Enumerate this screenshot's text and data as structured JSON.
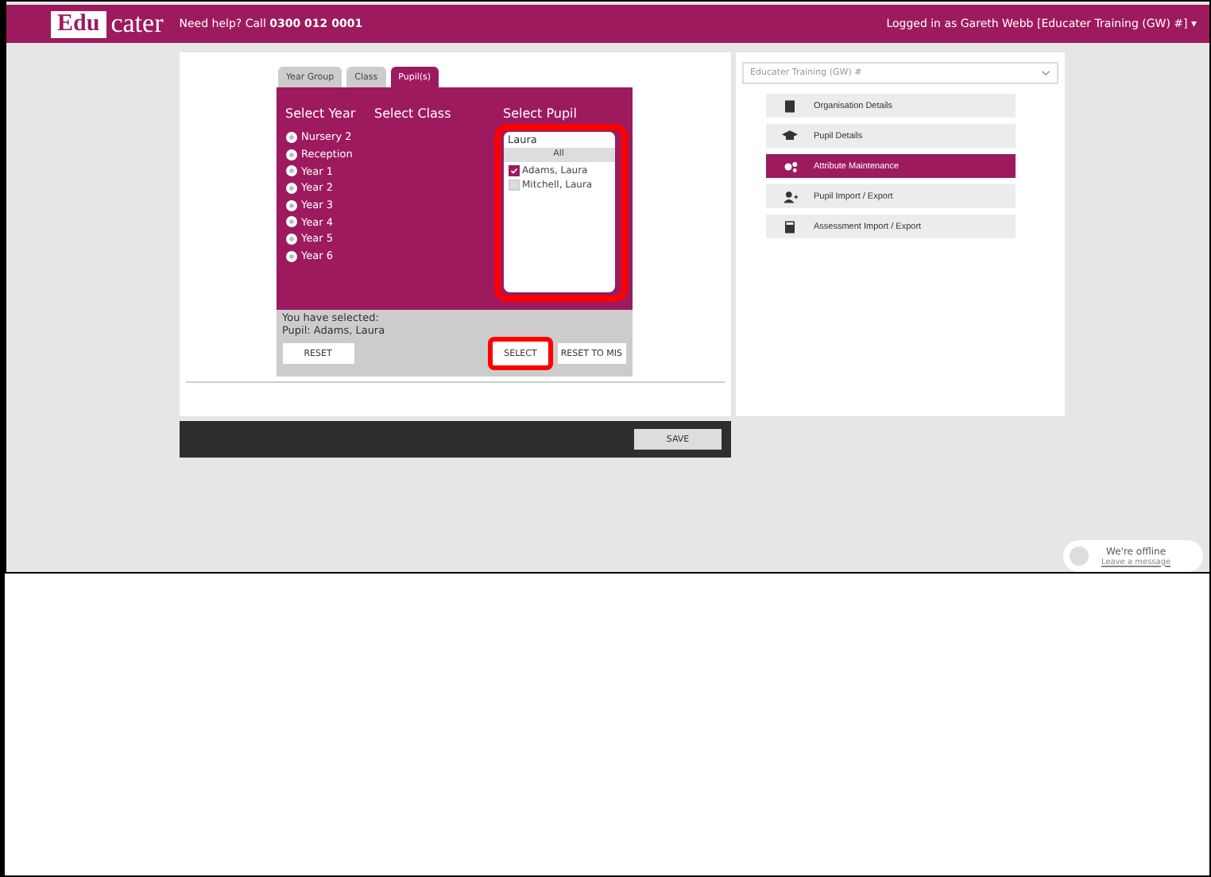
{
  "header": {
    "logo_left": "Edu",
    "logo_right": "cater",
    "help_text": "Need help? Call",
    "help_phone": "0300 012 0001",
    "user": "Logged in as Gareth Webb [Educater Training (GW) #]",
    "user_caret": "▾"
  },
  "tabs": [
    {
      "label": "Year Group",
      "selected": false
    },
    {
      "label": "Class",
      "selected": false
    },
    {
      "label": "Pupil(s)",
      "selected": true
    }
  ],
  "columns": {
    "year": "Select Year",
    "class": "Select Class",
    "pupil": "Select Pupil"
  },
  "years": [
    {
      "label": "Nursery 2",
      "selected": false
    },
    {
      "label": "Reception",
      "selected": false
    },
    {
      "label": "Year 1",
      "selected": false
    },
    {
      "label": "Year 2",
      "selected": false
    },
    {
      "label": "Year 3",
      "selected": false
    },
    {
      "label": "Year 4",
      "selected": false
    },
    {
      "label": "Year 5",
      "selected": false
    },
    {
      "label": "Year 6",
      "selected": false
    }
  ],
  "pupil_search": {
    "value": "Laura"
  },
  "pupil_all": "All",
  "pupils": [
    {
      "name": "Adams, Laura",
      "checked": true
    },
    {
      "name": "Mitchell, Laura",
      "checked": false
    }
  ],
  "selection": {
    "heading": "You have selected:",
    "text": "Pupil: Adams, Laura"
  },
  "buttons": {
    "reset": "RESET",
    "select": "SELECT",
    "reset_mis": "RESET TO MIS",
    "save": "SAVE"
  },
  "org_select": {
    "value": "Educater Training (GW) #"
  },
  "menu": [
    {
      "label": "Organisation Details",
      "selected": false
    },
    {
      "label": "Pupil Details",
      "selected": false
    },
    {
      "label": "Attribute Maintenance",
      "selected": true
    },
    {
      "label": "Pupil Import / Export",
      "selected": false
    },
    {
      "label": "Assessment Import / Export",
      "selected": false
    }
  ],
  "chat": {
    "status": "We're offline",
    "link": "Leave a message"
  }
}
